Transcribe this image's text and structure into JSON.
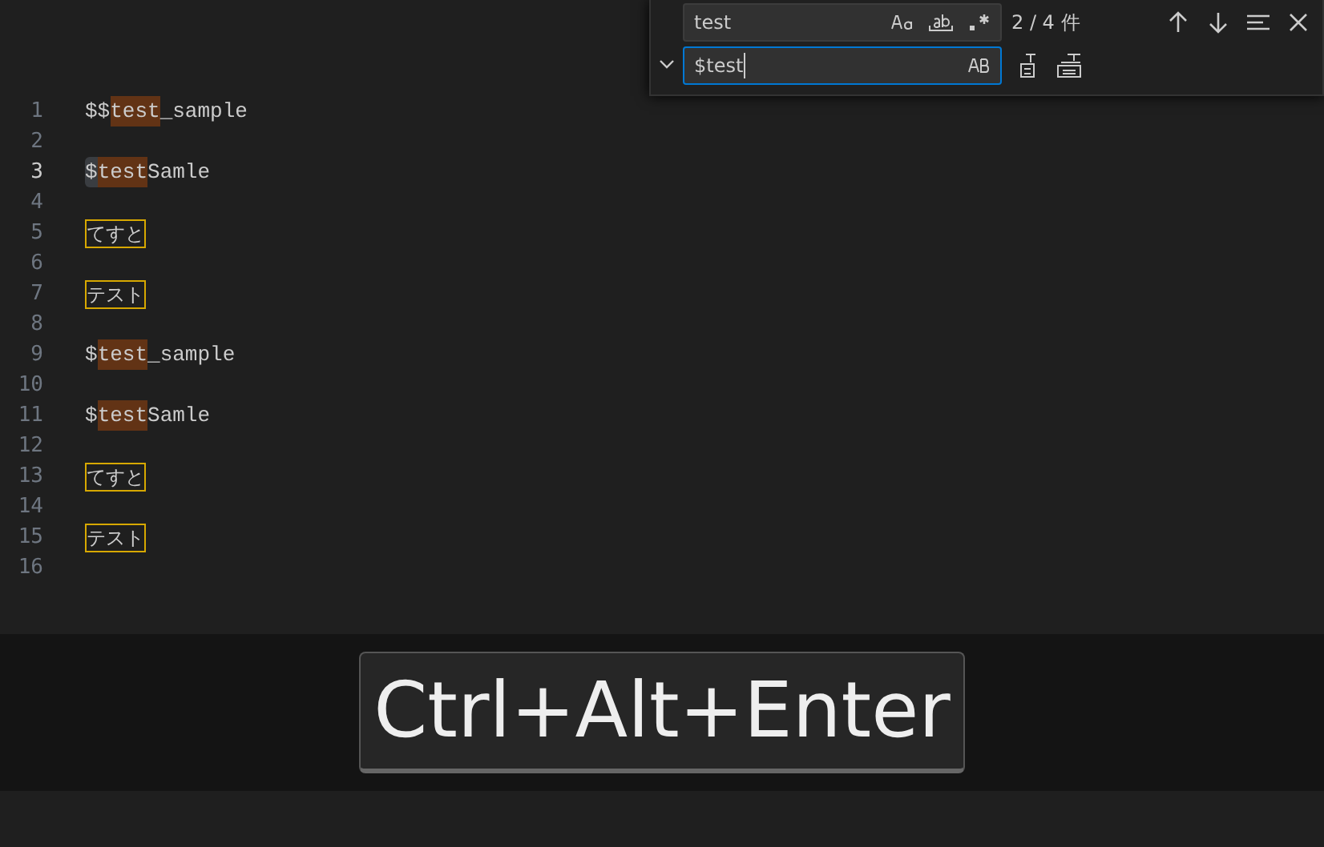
{
  "find_widget": {
    "expanded": true,
    "find_value": "test",
    "match_case": false,
    "whole_word": false,
    "regex": false,
    "match_count": "2 / 4 件",
    "replace_value": "$test",
    "preserve_case": false
  },
  "lines": [
    {
      "number": "1",
      "active": false,
      "segments": [
        {
          "text": "$$",
          "kind": "plain"
        },
        {
          "text": "test",
          "kind": "match"
        },
        {
          "text": "_sample",
          "kind": "plain"
        }
      ]
    },
    {
      "number": "2",
      "active": false
    },
    {
      "number": "3",
      "active": true,
      "segments": [
        {
          "text": "$",
          "kind": "selection"
        },
        {
          "text": "test",
          "kind": "match"
        },
        {
          "text": "Samle",
          "kind": "plain"
        }
      ]
    },
    {
      "number": "4",
      "active": false
    },
    {
      "number": "5",
      "active": false,
      "segments": [
        {
          "text": "てすと",
          "kind": "boxed"
        }
      ]
    },
    {
      "number": "6",
      "active": false
    },
    {
      "number": "7",
      "active": false,
      "segments": [
        {
          "text": "テスト",
          "kind": "boxed"
        }
      ]
    },
    {
      "number": "8",
      "active": false
    },
    {
      "number": "9",
      "active": false,
      "segments": [
        {
          "text": "$",
          "kind": "plain"
        },
        {
          "text": "test",
          "kind": "match"
        },
        {
          "text": "_sample",
          "kind": "plain"
        }
      ]
    },
    {
      "number": "10",
      "active": false
    },
    {
      "number": "11",
      "active": false,
      "segments": [
        {
          "text": "$",
          "kind": "plain"
        },
        {
          "text": "test",
          "kind": "match"
        },
        {
          "text": "Samle",
          "kind": "plain"
        }
      ]
    },
    {
      "number": "12",
      "active": false
    },
    {
      "number": "13",
      "active": false,
      "segments": [
        {
          "text": "てすと",
          "kind": "boxed"
        }
      ]
    },
    {
      "number": "14",
      "active": false
    },
    {
      "number": "15",
      "active": false,
      "segments": [
        {
          "text": "テスト",
          "kind": "boxed"
        }
      ]
    },
    {
      "number": "16",
      "active": false
    }
  ],
  "key_overlay": {
    "keys": "Ctrl+Alt+Enter"
  }
}
